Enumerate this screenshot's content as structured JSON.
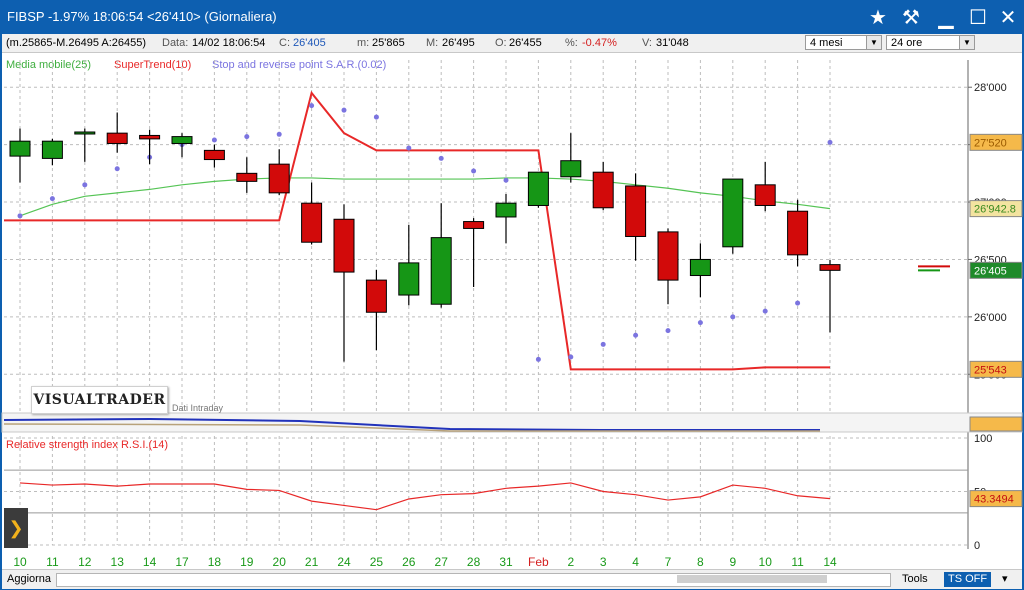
{
  "window": {
    "title": "FIBSP  -1.97%  18:06:54   <26'410>  (Giornaliera)"
  },
  "colors": {
    "accent": "#0d5fb0",
    "up": "#169616",
    "down": "#d20a0a",
    "ma": "#55c455",
    "supertrend": "#e82828",
    "sar": "#7b74e0",
    "rsi": "#e82828"
  },
  "info": {
    "range": "(m.25865-M.26495 A:26455)",
    "data_label": "Data:",
    "data_value": "14/02 18:06:54",
    "c_label": "C:",
    "c_value": "26'405",
    "m_label": "m:",
    "m_value": "25'865",
    "M_label": "M:",
    "M_value": "26'495",
    "O_label": "O:",
    "O_value": "26'455",
    "pct_label": "%:",
    "pct_value": "-0.47%",
    "V_label": "V:",
    "V_value": "31'048",
    "period": "4 mesi",
    "timeframe": "24 ore"
  },
  "legend": {
    "ma": "Media mobile(25)",
    "supertrend": "SuperTrend(10)",
    "sar": "Stop and reverse point S.A.R.(0.02)",
    "rsi": "Relative strength index R.S.I.(14)"
  },
  "logo": {
    "name": "VISUALTRADER",
    "sub": "Dati Intraday"
  },
  "price_axis": {
    "ticks": [
      "28'000",
      "27'500",
      "27'000",
      "26'500",
      "26'000",
      "25'500"
    ]
  },
  "tags": {
    "t27520": "27'520",
    "ma": "26'942.8",
    "last": "26'405",
    "st": "25'543",
    "rsi": "43.3494"
  },
  "rsi_axis": {
    "ticks": [
      "100",
      "50",
      "0"
    ]
  },
  "x_labels": [
    "10",
    "11",
    "12",
    "13",
    "14",
    "17",
    "18",
    "19",
    "20",
    "21",
    "24",
    "25",
    "26",
    "27",
    "28",
    "31",
    "Feb",
    "2",
    "3",
    "4",
    "7",
    "8",
    "9",
    "10",
    "11",
    "14"
  ],
  "chart_data": {
    "type": "candlestick",
    "x": [
      "10",
      "11",
      "12",
      "13",
      "14",
      "17",
      "18",
      "19",
      "20",
      "21",
      "24",
      "25",
      "26",
      "27",
      "28",
      "31",
      "Feb",
      "2",
      "3",
      "4",
      "7",
      "8",
      "9",
      "10",
      "11",
      "14"
    ],
    "ylim": [
      25450,
      28150
    ],
    "candles": [
      {
        "o": 27400,
        "h": 27640,
        "l": 27170,
        "c": 27530
      },
      {
        "o": 27380,
        "h": 27550,
        "l": 27320,
        "c": 27530
      },
      {
        "o": 27610,
        "h": 27640,
        "l": 27350,
        "c": 27610
      },
      {
        "o": 27600,
        "h": 27780,
        "l": 27430,
        "c": 27510
      },
      {
        "o": 27580,
        "h": 27630,
        "l": 27330,
        "c": 27550
      },
      {
        "o": 27510,
        "h": 27600,
        "l": 27390,
        "c": 27570
      },
      {
        "o": 27450,
        "h": 27500,
        "l": 27300,
        "c": 27370
      },
      {
        "o": 27250,
        "h": 27390,
        "l": 27080,
        "c": 27180
      },
      {
        "o": 27330,
        "h": 27460,
        "l": 27060,
        "c": 27080
      },
      {
        "o": 26990,
        "h": 27170,
        "l": 26630,
        "c": 26650
      },
      {
        "o": 26850,
        "h": 26980,
        "l": 25610,
        "c": 26390
      },
      {
        "o": 26320,
        "h": 26410,
        "l": 25710,
        "c": 26040
      },
      {
        "o": 26190,
        "h": 26800,
        "l": 26100,
        "c": 26470
      },
      {
        "o": 26110,
        "h": 26990,
        "l": 26080,
        "c": 26690
      },
      {
        "o": 26830,
        "h": 26860,
        "l": 26260,
        "c": 26770
      },
      {
        "o": 26870,
        "h": 27070,
        "l": 26640,
        "c": 26990
      },
      {
        "o": 26970,
        "h": 27250,
        "l": 26950,
        "c": 27260
      },
      {
        "o": 27220,
        "h": 27600,
        "l": 27170,
        "c": 27360
      },
      {
        "o": 27260,
        "h": 27350,
        "l": 26930,
        "c": 26950
      },
      {
        "o": 27140,
        "h": 27250,
        "l": 26490,
        "c": 26700
      },
      {
        "o": 26740,
        "h": 26770,
        "l": 26110,
        "c": 26320
      },
      {
        "o": 26360,
        "h": 26640,
        "l": 26170,
        "c": 26500
      },
      {
        "o": 26610,
        "h": 27200,
        "l": 26550,
        "c": 27200
      },
      {
        "o": 27150,
        "h": 27350,
        "l": 26920,
        "c": 26970
      },
      {
        "o": 26920,
        "h": 27020,
        "l": 26440,
        "c": 26540
      },
      {
        "o": 26455,
        "h": 26495,
        "l": 25865,
        "c": 26405
      }
    ],
    "ma25": [
      26880,
      26980,
      27050,
      27080,
      27110,
      27150,
      27180,
      27200,
      27210,
      27210,
      27200,
      27200,
      27200,
      27200,
      27200,
      27210,
      27210,
      27200,
      27180,
      27150,
      27120,
      27080,
      27050,
      27010,
      26980,
      26942.8
    ],
    "supertrend": [
      26840,
      26840,
      26840,
      26840,
      26840,
      26840,
      26840,
      26840,
      26840,
      27950,
      27600,
      27450,
      27450,
      27450,
      27450,
      27450,
      27450,
      25543,
      25543,
      25543,
      25543,
      25543,
      25543,
      25560,
      25560,
      25560
    ],
    "sar": [
      26880,
      27030,
      27150,
      27290,
      27390,
      27500,
      27540,
      27570,
      27590,
      27840,
      27800,
      27740,
      27470,
      27380,
      27270,
      27190,
      25630,
      25650,
      25760,
      25840,
      25880,
      25950,
      26000,
      26050,
      26120,
      27520
    ],
    "rsi": [
      58,
      56,
      57,
      55,
      57,
      57,
      57,
      52,
      51,
      41,
      37,
      33,
      43,
      47,
      48,
      53,
      55,
      58,
      50,
      47,
      42,
      45,
      56,
      53,
      46,
      43.35
    ],
    "rsi_ylim": [
      0,
      100
    ]
  }
}
